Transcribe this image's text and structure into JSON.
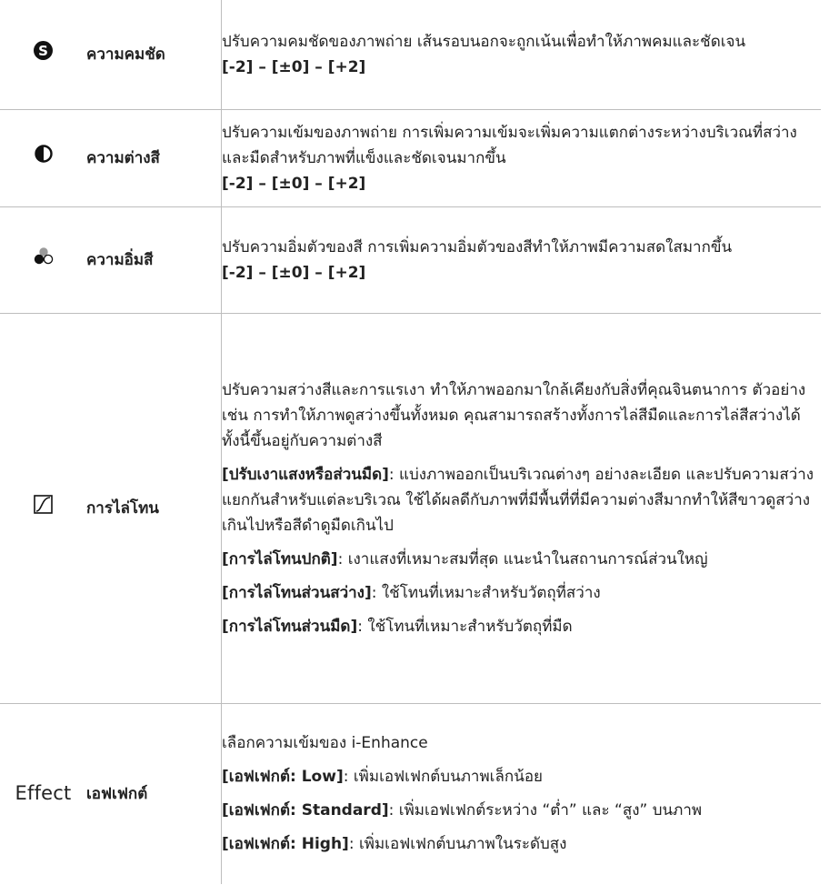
{
  "rows": [
    {
      "icon": "sharpness-icon",
      "name": "ความคมชัด",
      "description": "ปรับความคมชัดของภาพถ่าย เส้นรอบนอกจะถูกเน้นเพื่อทำให้ภาพคมและชัดเจน",
      "range": "[-2] – [±0] – [+2]"
    },
    {
      "icon": "contrast-icon",
      "name": "ความต่างสี",
      "description": "ปรับความเข้มของภาพถ่าย การเพิ่มความเข้มจะเพิ่มความแตกต่างระหว่างบริเวณที่สว่างและมืดสำหรับภาพที่แข็งและชัดเจนมากขึ้น",
      "range": "[-2] – [±0] – [+2]"
    },
    {
      "icon": "saturation-icon",
      "name": "ความอิ่มสี",
      "description": "ปรับความอิ่มตัวของสี การเพิ่มความอิ่มตัวของสีทำให้ภาพมีความสดใสมากขึ้น",
      "range": "[-2] – [±0] – [+2]"
    },
    {
      "icon": "gradation-icon",
      "name": "การไล่โทน",
      "intro": "ปรับความสว่างสีและการแรเงา ทำให้ภาพออกมาใกล้เคียงกับสิ่งที่คุณจินตนาการ ตัวอย่างเช่น การทำให้ภาพดูสว่างขึ้นทั้งหมด คุณสามารถสร้างทั้งการไล่สีมืดและการไล่สีสว่างได้ ทั้งนี้ขึ้นอยู่กับความต่างสี",
      "options": [
        {
          "label": "[ปรับเงาแสงหรือส่วนมืด]",
          "text": ": แบ่งภาพออกเป็นบริเวณต่างๆ อย่างละเอียด และปรับความสว่างแยกกันสำหรับแต่ละบริเวณ ใช้ได้ผลดีกับภาพที่มีพื้นที่ที่มีความต่างสีมากทำให้สีขาวดูสว่างเกินไปหรือสีดำดูมืดเกินไป"
        },
        {
          "label": "[การไล่โทนปกติ]",
          "text": ": เงาแสงที่เหมาะสมที่สุด แนะนำในสถานการณ์ส่วนใหญ่"
        },
        {
          "label": "[การไล่โทนส่วนสว่าง]",
          "text": ": ใช้โทนที่เหมาะสำหรับวัตถุที่สว่าง"
        },
        {
          "label": "[การไล่โทนส่วนมืด]",
          "text": ": ใช้โทนที่เหมาะสำหรับวัตถุที่มืด"
        }
      ]
    },
    {
      "icon_text": "Effect",
      "name": "เอฟเฟกต์",
      "intro": "เลือกความเข้มของ i-Enhance",
      "options": [
        {
          "label": "[เอฟเฟกต์: Low]",
          "text": ": เพิ่มเอฟเฟกต์บนภาพเล็กน้อย"
        },
        {
          "label": "[เอฟเฟกต์: Standard]",
          "text": ": เพิ่มเอฟเฟกต์ระหว่าง “ต่ำ” และ “สูง” บนภาพ"
        },
        {
          "label": "[เอฟเฟกต์: High]",
          "text": ": เพิ่มเอฟเฟกต์บนภาพในระดับสูง"
        }
      ]
    }
  ]
}
